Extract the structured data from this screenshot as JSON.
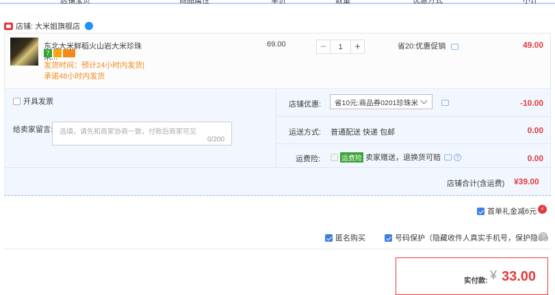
{
  "header": {
    "col_product": "店铺宝贝",
    "col_attr": "商品属性",
    "col_price": "单价",
    "col_qty": "数量",
    "col_promo": "优惠方式",
    "col_subtotal": "小计"
  },
  "shop": {
    "label": "店铺: 大米姐旗舰店"
  },
  "item": {
    "name": "东北大米鲜稻火山岩大米珍珠米...",
    "badge_1": "7",
    "shipping_note": "发货时间：预计24小时内发货|承诺48小时内发货",
    "unit_price": "69.00",
    "quantity": "1",
    "promo": "省20:优惠促销",
    "subtotal": "49.00"
  },
  "options": {
    "invoice_label": "开具发票",
    "message_label": "给卖家留言:",
    "message_placeholder": "选填，请先和商家协商一致，付款后商家可见",
    "message_counter": "0/200",
    "shop_discount_label": "店铺优惠:",
    "shop_discount_value": "省10元:商品券0201珍珠米",
    "shop_discount_amount": "-10.00",
    "delivery_label": "运送方式:",
    "delivery_value": "普通配送 快递 包邮",
    "delivery_amount": "0.00",
    "insurance_label": "运费险:",
    "insurance_tag": "运费险",
    "insurance_value": "卖家赠送，退换货可赔",
    "insurance_amount": "0.00",
    "shop_total_label": "店铺合计(含运费)",
    "shop_total_value": "¥39.00"
  },
  "extras": {
    "first_order_label": "首单礼金减6元",
    "anonymous_label": "匿名购买",
    "privacy_label": "号码保护（隐藏收件人真实手机号，保护隐私）"
  },
  "payment": {
    "label": "实付款:",
    "currency": "¥",
    "amount": "33.00"
  },
  "colors": {
    "accent_red": "#e4393c",
    "accent_blue": "#3d7fe0",
    "panel_bg": "#f2f7ff"
  }
}
